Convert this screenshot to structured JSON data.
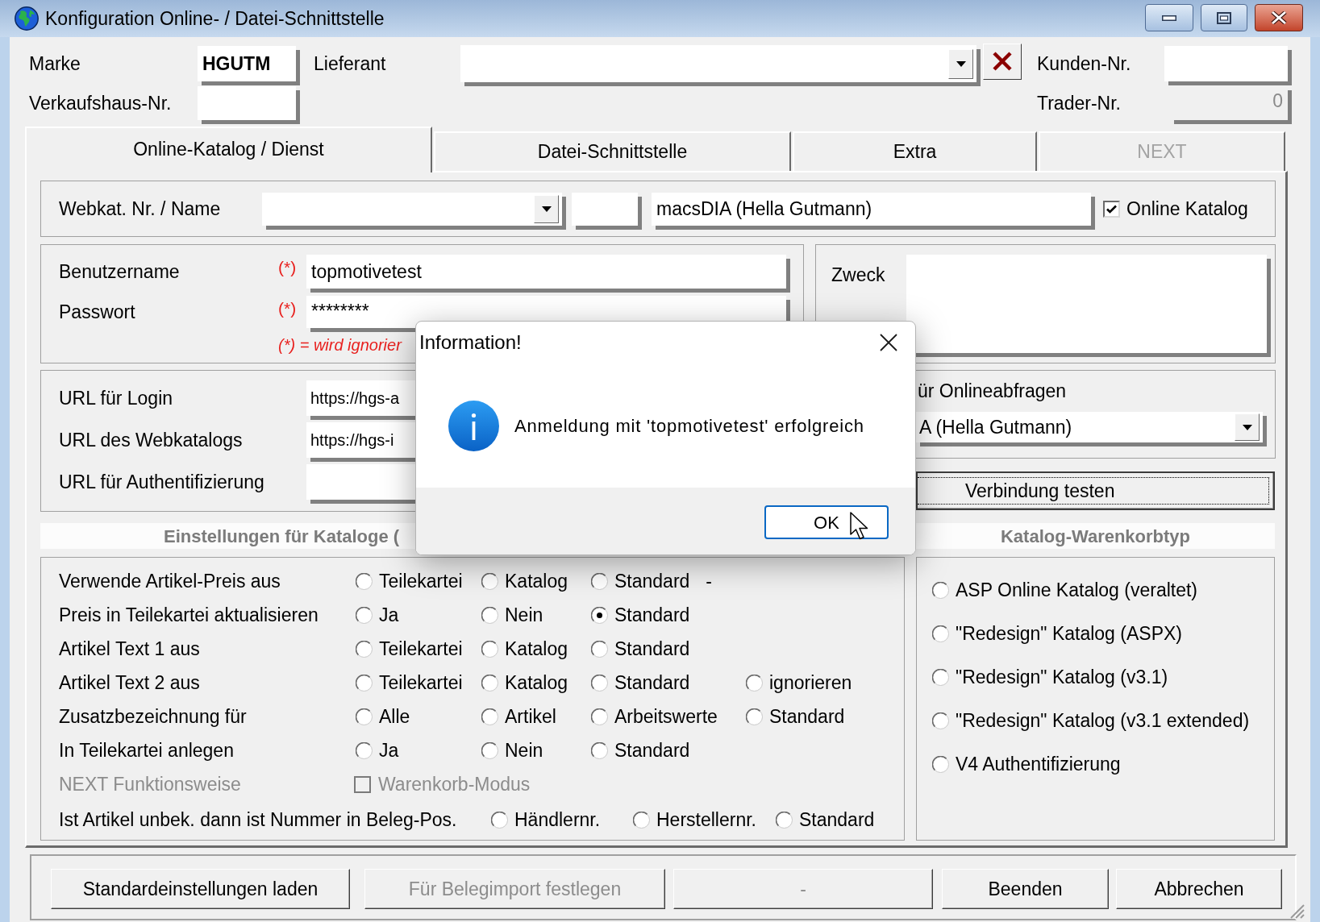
{
  "window": {
    "title": "Konfiguration Online- / Datei-Schnittstelle"
  },
  "header": {
    "marke": {
      "label": "Marke",
      "value": "HGUTM",
      "disabled": false
    },
    "lieferant": {
      "label": "Lieferant"
    },
    "kunden_nr": {
      "label": "Kunden-Nr.",
      "disabled": false
    },
    "verkaufshaus_nr": {
      "label": "Verkaufshaus-Nr.",
      "disabled": false
    },
    "trader_nr": {
      "label": "Trader-Nr.",
      "value": "0",
      "disabled": true
    }
  },
  "tabs": [
    {
      "label": "Online-Katalog / Dienst",
      "selected": true,
      "disabled": false
    },
    {
      "label": "Datei-Schnittstelle",
      "selected": false,
      "disabled": false
    },
    {
      "label": "Extra",
      "selected": false,
      "disabled": false
    },
    {
      "label": "NEXT",
      "selected": false,
      "disabled": true
    }
  ],
  "webkat": {
    "label": "Webkat. Nr. / Name",
    "name": "macsDIA (Hella Gutmann)",
    "online_katalog": {
      "label": "Online Katalog",
      "checked": true
    }
  },
  "credentials": {
    "fields": [
      {
        "label": "Benutzername",
        "required_mark": "(*)",
        "value": "topmotivetest"
      },
      {
        "label": "Passwort",
        "required_mark": "(*)",
        "value": "********"
      }
    ],
    "footnote": "(*) = wird ignorier"
  },
  "purpose": {
    "label": "Zweck"
  },
  "urls": [
    {
      "label": "URL für Login",
      "value": "https://hgs-a"
    },
    {
      "label": "URL des Webkatalogs",
      "value": "https://hgs-i"
    },
    {
      "label": "URL für Authentifizierung"
    }
  ],
  "online_queries": {
    "label": "ür Onlineabfragen",
    "value": "A (Hella Gutmann)"
  },
  "test_button": {
    "label": "Verbindung testen",
    "focused": true
  },
  "catalog_settings": {
    "title": "Einstellungen für Kataloge (",
    "rows": [
      {
        "kind": "radio",
        "label": "Verwende Artikel-Preis aus",
        "disabled": false,
        "options": [
          {
            "label": "Teilekartei",
            "selected": false
          },
          {
            "label": "Katalog",
            "selected": false
          },
          {
            "label": "Standard",
            "selected": false
          }
        ],
        "suffix": "-"
      },
      {
        "kind": "radio",
        "label": "Preis in Teilekartei aktualisieren",
        "disabled": false,
        "options": [
          {
            "label": "Ja",
            "selected": false
          },
          {
            "label": "Nein",
            "selected": false
          },
          {
            "label": "Standard",
            "selected": true
          }
        ]
      },
      {
        "kind": "radio",
        "label": "Artikel Text 1 aus",
        "disabled": false,
        "options": [
          {
            "label": "Teilekartei",
            "selected": false
          },
          {
            "label": "Katalog",
            "selected": false
          },
          {
            "label": "Standard",
            "selected": false
          }
        ]
      },
      {
        "kind": "radio",
        "label": "Artikel Text 2 aus",
        "disabled": false,
        "options": [
          {
            "label": "Teilekartei",
            "selected": false
          },
          {
            "label": "Katalog",
            "selected": false
          },
          {
            "label": "Standard",
            "selected": false
          },
          {
            "label": "ignorieren",
            "selected": false
          }
        ]
      },
      {
        "kind": "radio",
        "label": "Zusatzbezeichnung für",
        "disabled": false,
        "options": [
          {
            "label": "Alle",
            "selected": false
          },
          {
            "label": "Artikel",
            "selected": false
          },
          {
            "label": "Arbeitswerte",
            "selected": false
          },
          {
            "label": "Standard",
            "selected": false
          }
        ]
      },
      {
        "kind": "radio",
        "label": "In Teilekartei anlegen",
        "disabled": false,
        "options": [
          {
            "label": "Ja",
            "selected": false
          },
          {
            "label": "Nein",
            "selected": false
          },
          {
            "label": "Standard",
            "selected": false
          }
        ]
      },
      {
        "kind": "checkbox",
        "label": "NEXT Funktionsweise",
        "disabled": true,
        "option": {
          "label": "Warenkorb-Modus",
          "checked": false
        }
      },
      {
        "kind": "radio_inline",
        "label": "Ist Artikel unbek. dann ist Nummer in Beleg-Pos.",
        "disabled": false,
        "options": [
          {
            "label": "Händlernr.",
            "selected": false
          },
          {
            "label": "Herstellernr.",
            "selected": false
          },
          {
            "label": "Standard",
            "selected": false
          }
        ]
      }
    ]
  },
  "basket_type": {
    "title": "Katalog-Warenkorbtyp",
    "options": [
      {
        "label": "ASP Online Katalog (veraltet)",
        "selected": false
      },
      {
        "label": "\"Redesign\" Katalog (ASPX)",
        "selected": false
      },
      {
        "label": "\"Redesign\" Katalog (v3.1)",
        "selected": false
      },
      {
        "label": "\"Redesign\" Katalog (v3.1 extended)",
        "selected": false
      },
      {
        "label": "V4 Authentifizierung",
        "selected": false
      }
    ]
  },
  "footer_buttons": [
    {
      "label": "Standardeinstellungen laden",
      "disabled": false
    },
    {
      "label": "Für Belegimport festlegen",
      "disabled": true
    },
    {
      "label": "-",
      "disabled": true
    },
    {
      "label": "Beenden",
      "disabled": false
    },
    {
      "label": "Abbrechen",
      "disabled": false
    }
  ],
  "dialog": {
    "title": "Information!",
    "message": "Anmeldung mit 'topmotivetest' erfolgreich",
    "button": "OK"
  }
}
